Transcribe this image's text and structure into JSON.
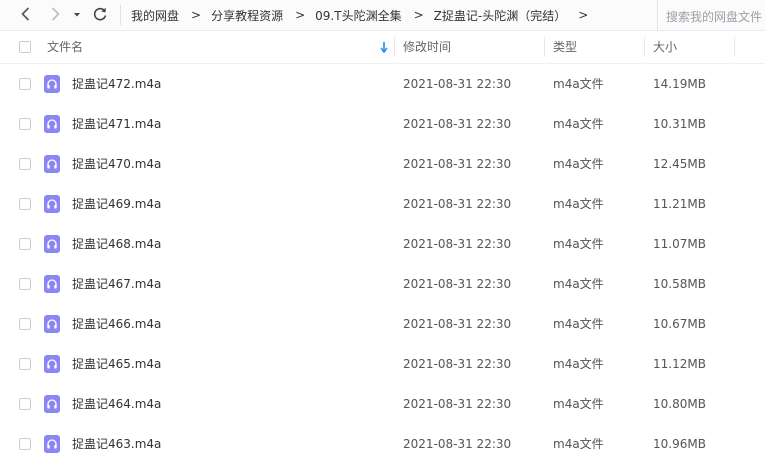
{
  "breadcrumb": [
    "我的网盘",
    "分享教程资源",
    "09.T头陀渊全集",
    "Z捉蛊记-头陀渊（完结）"
  ],
  "breadcrumb_arrow": ">",
  "search": {
    "placeholder": "搜索我的网盘文件"
  },
  "columns": {
    "name": "文件名",
    "modified": "修改时间",
    "type": "类型",
    "size": "大小"
  },
  "files": [
    {
      "name": "捉蛊记472.m4a",
      "modified": "2021-08-31 22:30",
      "type": "m4a文件",
      "size": "14.19MB"
    },
    {
      "name": "捉蛊记471.m4a",
      "modified": "2021-08-31 22:30",
      "type": "m4a文件",
      "size": "10.31MB"
    },
    {
      "name": "捉蛊记470.m4a",
      "modified": "2021-08-31 22:30",
      "type": "m4a文件",
      "size": "12.45MB"
    },
    {
      "name": "捉蛊记469.m4a",
      "modified": "2021-08-31 22:30",
      "type": "m4a文件",
      "size": "11.21MB"
    },
    {
      "name": "捉蛊记468.m4a",
      "modified": "2021-08-31 22:30",
      "type": "m4a文件",
      "size": "11.07MB"
    },
    {
      "name": "捉蛊记467.m4a",
      "modified": "2021-08-31 22:30",
      "type": "m4a文件",
      "size": "10.58MB"
    },
    {
      "name": "捉蛊记466.m4a",
      "modified": "2021-08-31 22:30",
      "type": "m4a文件",
      "size": "10.67MB"
    },
    {
      "name": "捉蛊记465.m4a",
      "modified": "2021-08-31 22:30",
      "type": "m4a文件",
      "size": "11.12MB"
    },
    {
      "name": "捉蛊记464.m4a",
      "modified": "2021-08-31 22:30",
      "type": "m4a文件",
      "size": "10.80MB"
    },
    {
      "name": "捉蛊记463.m4a",
      "modified": "2021-08-31 22:30",
      "type": "m4a文件",
      "size": "10.96MB"
    }
  ],
  "colors": {
    "file_icon": "#8c86f5",
    "sort_arrow": "#2b8cf0"
  },
  "icons": {
    "back": "chevron-left-icon",
    "forward": "chevron-right-icon",
    "history": "caret-down-icon",
    "refresh": "refresh-icon",
    "file": "headphones-icon",
    "sort": "sort-down-arrow-icon"
  }
}
